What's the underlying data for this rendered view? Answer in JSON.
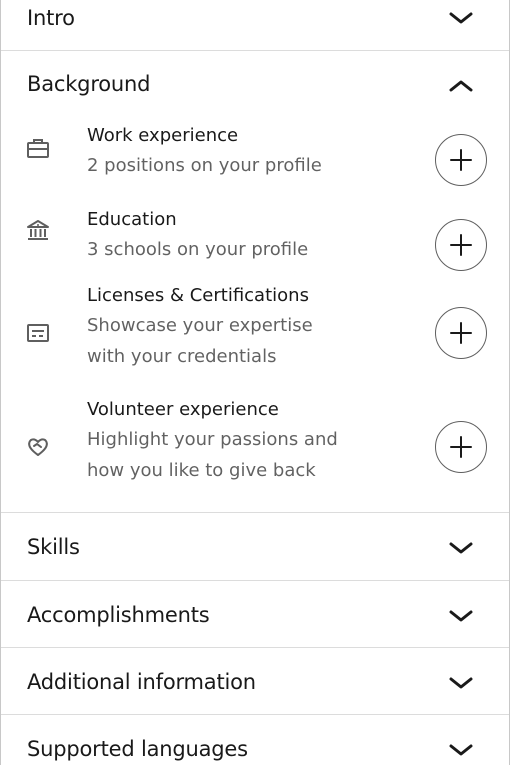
{
  "sections": {
    "intro": {
      "title": "Intro",
      "state": "collapsed",
      "icon": "chevron-down-icon"
    },
    "background": {
      "title": "Background",
      "state": "expanded",
      "icon": "chevron-up-icon",
      "items": [
        {
          "title": "Work experience",
          "subtitle": "2 positions on your profile",
          "icon": "briefcase-icon",
          "action_icon": "plus-icon"
        },
        {
          "title": "Education",
          "subtitle": "3 schools on your profile",
          "icon": "school-icon",
          "action_icon": "plus-icon"
        },
        {
          "title": "Licenses & Certifications",
          "subtitle_line1": "Showcase your expertise",
          "subtitle_line2": "with your credentials",
          "icon": "certificate-icon",
          "action_icon": "plus-icon"
        },
        {
          "title": "Volunteer experience",
          "subtitle_line1": "Highlight your passions and",
          "subtitle_line2": "how you like to give back",
          "icon": "heart-hand-icon",
          "action_icon": "plus-icon"
        }
      ]
    },
    "skills": {
      "title": "Skills",
      "state": "collapsed",
      "icon": "chevron-down-icon"
    },
    "accomplishments": {
      "title": "Accomplishments",
      "state": "collapsed",
      "icon": "chevron-down-icon"
    },
    "additional": {
      "title": "Additional information",
      "state": "collapsed",
      "icon": "chevron-down-icon"
    },
    "languages": {
      "title": "Supported languages",
      "state": "collapsed",
      "icon": "chevron-down-icon"
    }
  },
  "colors": {
    "text_primary": "#1a1a1a",
    "text_secondary": "#5e5e5e",
    "divider": "#dcdcdc",
    "icon": "#5f5f5f"
  }
}
